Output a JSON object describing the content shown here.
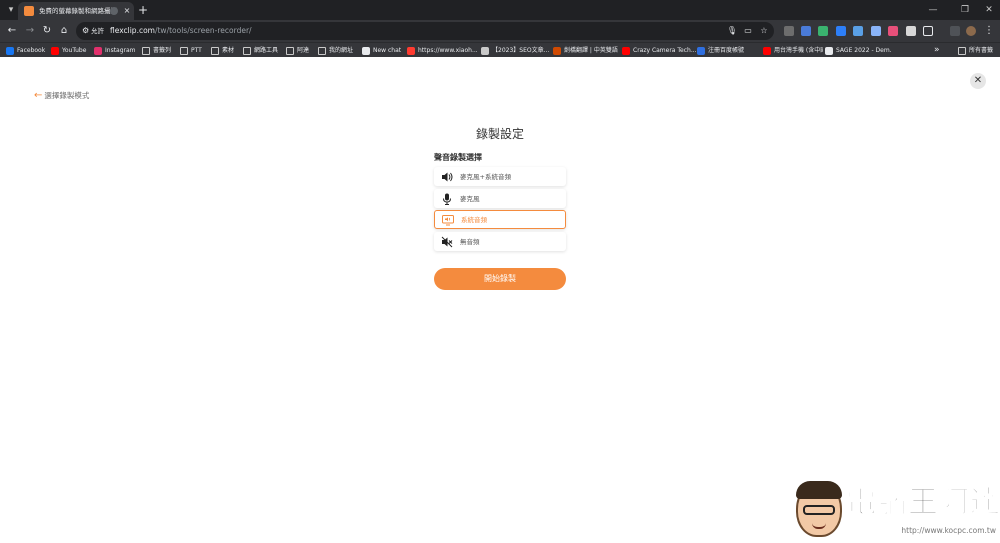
{
  "browser": {
    "tab": {
      "title": "免費的螢幕錄製和網路攝影機",
      "close": "×"
    },
    "new_tab": "+",
    "window_controls": {
      "minimize": "—",
      "maximize": "❐",
      "close": "✕"
    },
    "omnibox": {
      "permission_label": "允許",
      "url_host": "flexclip.com",
      "url_path": "/tw/tools/screen-recorder/"
    },
    "bookmarks": [
      {
        "label": "Facebook",
        "icon": "facebook-icon",
        "color": "#1877f2"
      },
      {
        "label": "YouTube",
        "icon": "youtube-icon",
        "color": "#ff0000"
      },
      {
        "label": "Instagram",
        "icon": "instagram-icon",
        "color": "#e1306c"
      },
      {
        "label": "書籤列",
        "icon": "folder-icon",
        "color": ""
      },
      {
        "label": "PTT",
        "icon": "folder-icon",
        "color": ""
      },
      {
        "label": "素材",
        "icon": "folder-icon",
        "color": ""
      },
      {
        "label": "網路工具",
        "icon": "folder-icon",
        "color": ""
      },
      {
        "label": "阿達",
        "icon": "folder-icon",
        "color": ""
      },
      {
        "label": "我的網址",
        "icon": "folder-icon",
        "color": ""
      },
      {
        "label": "New chat",
        "icon": "chatgpt-icon",
        "color": "#e8eaed"
      },
      {
        "label": "https://www.xiaoh...",
        "icon": "site-icon",
        "color": "#ff3b30"
      },
      {
        "label": "【2023】SEO文章...",
        "icon": "globe-icon",
        "color": "#c9c9c9"
      },
      {
        "label": "劍橋翻譯 | 中英雙語",
        "icon": "cambridge-icon",
        "color": "#d04a02"
      },
      {
        "label": "Crazy Camera Tech...",
        "icon": "youtube-icon",
        "color": "#ff0000"
      },
      {
        "label": "注冊百度帳號",
        "icon": "baidu-icon",
        "color": "#2f6fe0"
      },
      {
        "label": "用台灣手機 (含中國...",
        "icon": "youtube-icon",
        "color": "#ff0000"
      },
      {
        "label": "SAGE 2022 - Dem...",
        "icon": "sage-icon",
        "color": "#e8eaed"
      }
    ],
    "bookmarks_more": "»",
    "all_bookmarks": "所有書籤"
  },
  "page": {
    "back_link": {
      "arrow": "←",
      "label": "選擇錄製模式"
    },
    "close": "✕",
    "title": "錄製設定",
    "section_label": "聲音錄製選擇",
    "options": [
      {
        "label": "麥克風+系統音頻",
        "icon": "speaker-icon",
        "selected": false
      },
      {
        "label": "麥克風",
        "icon": "microphone-icon",
        "selected": false
      },
      {
        "label": "系統音頻",
        "icon": "screen-audio-icon",
        "selected": true
      },
      {
        "label": "無音頻",
        "icon": "mute-icon",
        "selected": false
      }
    ],
    "start_button": "開始錄製"
  },
  "watermark": {
    "text": "電腦王阿達",
    "url": "http://www.kocpc.com.tw"
  },
  "colors": {
    "accent": "#f48b3e",
    "chrome_dark": "#202124",
    "chrome_toolbar": "#35363a"
  }
}
